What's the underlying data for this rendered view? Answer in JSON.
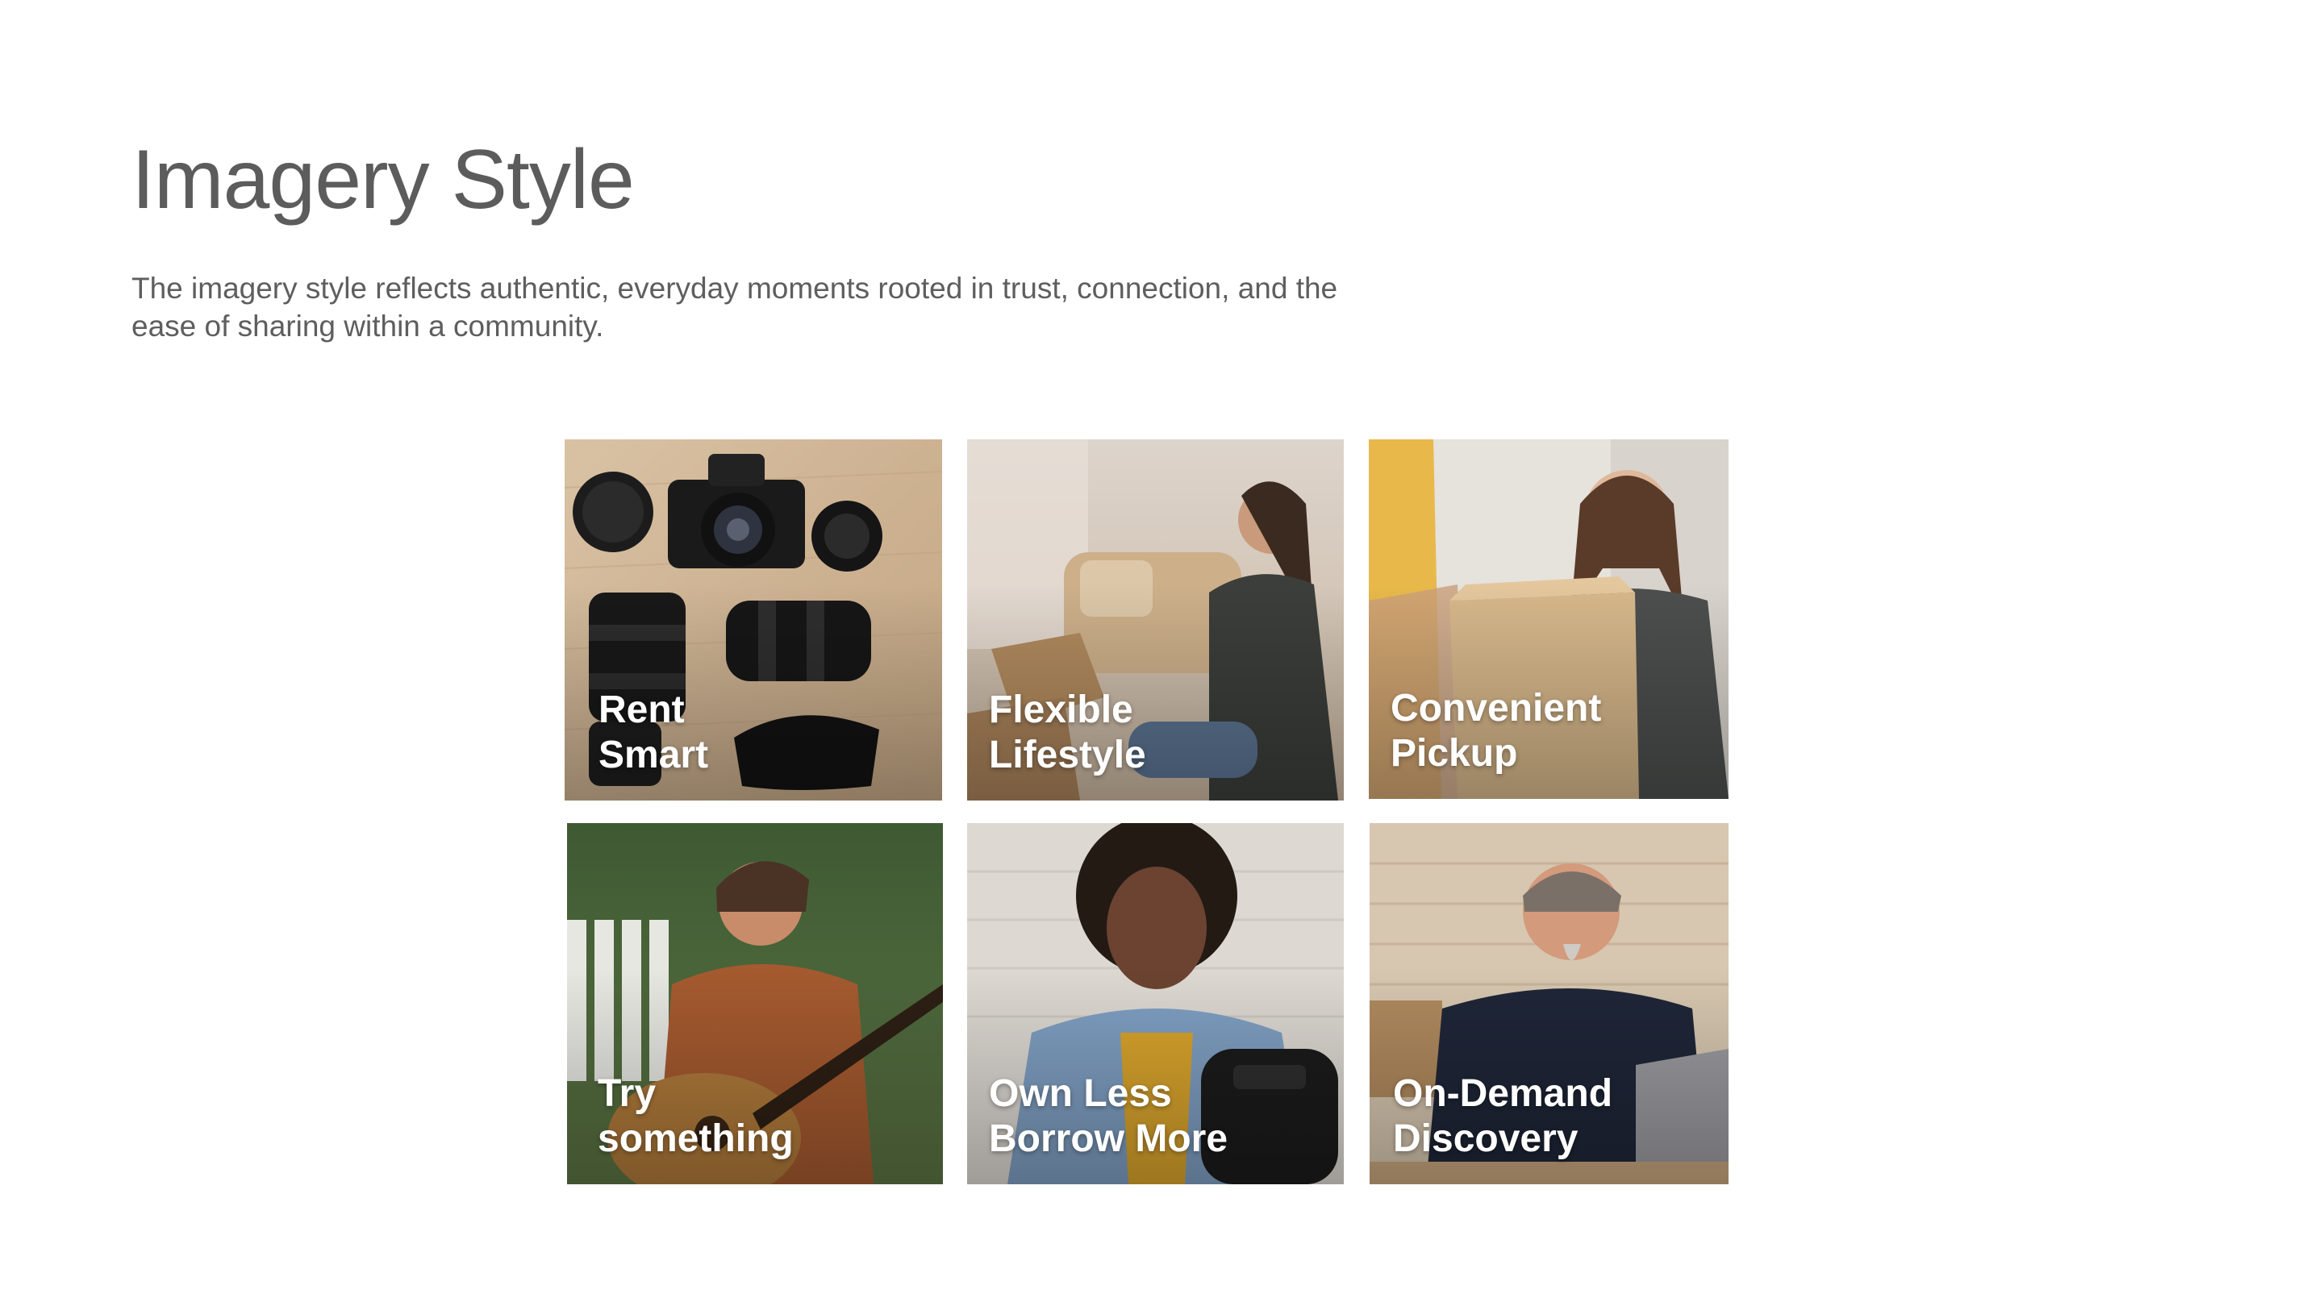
{
  "page": {
    "title": "Imagery Style",
    "description": "The imagery style reflects authentic, everyday moments rooted in trust, connection, and the ease of sharing within a community."
  },
  "tiles": [
    {
      "line1": "Rent",
      "line2": "Smart",
      "photo": "camera-gear-flatlay-photo"
    },
    {
      "line1": "Flexible",
      "line2": "Lifestyle",
      "photo": "woman-on-sofa-photo"
    },
    {
      "line1": "Convenient",
      "line2": "Pickup",
      "photo": "woman-receiving-box-photo"
    },
    {
      "line1": "Try",
      "line2": "something",
      "photo": "man-playing-guitar-photo"
    },
    {
      "line1": "Own Less",
      "line2": "Borrow More",
      "photo": "woman-with-backpack-photo"
    },
    {
      "line1": "On-Demand",
      "line2": "Discovery",
      "photo": "man-with-laptop-photo"
    }
  ]
}
